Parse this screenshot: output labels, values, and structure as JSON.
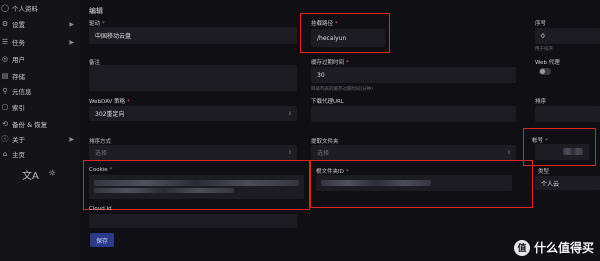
{
  "sidebar": {
    "items": [
      {
        "icon": "person-icon",
        "glyph": "◯",
        "label": "个人资料",
        "chevron": false
      },
      {
        "icon": "gear-icon",
        "glyph": "⚙",
        "label": "设置",
        "chevron": true
      },
      {
        "icon": "task-icon",
        "glyph": "☰",
        "label": "任务",
        "chevron": true
      },
      {
        "icon": "users-icon",
        "glyph": "◎",
        "label": "用户",
        "chevron": false
      },
      {
        "icon": "storage-icon",
        "glyph": "▤",
        "label": "存储",
        "chevron": false
      },
      {
        "icon": "meta-icon",
        "glyph": "⚲",
        "label": "元信息",
        "chevron": false
      },
      {
        "icon": "index-icon",
        "glyph": "▢",
        "label": "索引",
        "chevron": false
      },
      {
        "icon": "backup-icon",
        "glyph": "⟲",
        "label": "备份 & 恢复",
        "chevron": false
      },
      {
        "icon": "about-icon",
        "glyph": "ⓘ",
        "label": "关于",
        "chevron": true
      },
      {
        "icon": "home-icon",
        "glyph": "⌂",
        "label": "主页",
        "chevron": false
      }
    ],
    "language_glyph": "文A",
    "theme_glyph": "☼"
  },
  "form": {
    "title": "编辑",
    "driver": {
      "label": "驱动",
      "value": "中国移动云盘"
    },
    "mount_path": {
      "label": "挂载路径",
      "value": "/hecaiyun"
    },
    "order": {
      "label": "序号",
      "value": "0",
      "hint": "用于排序"
    },
    "remark": {
      "label": "备注",
      "value": ""
    },
    "cache": {
      "label": "缓存过期时间",
      "value": "30",
      "hint": "目录列表的缓存过期时间(分钟)"
    },
    "web_proxy": {
      "label": "Web 代理"
    },
    "webdav_policy": {
      "label": "WebDAV 策略",
      "value": "302重定向"
    },
    "download_proxy": {
      "label": "下载代理URL",
      "value": ""
    },
    "sort": {
      "label": "排序"
    },
    "order_by": {
      "label": "排序方式",
      "value": "选择"
    },
    "extract_folder": {
      "label": "提取文件夹",
      "value": "选择"
    },
    "account": {
      "label": "帐号"
    },
    "cookie": {
      "label": "Cookie"
    },
    "root_folder": {
      "label": "根文件夹ID"
    },
    "type": {
      "label": "类型",
      "value": "个人云"
    },
    "cloud_id": {
      "label": "Cloud Id"
    },
    "save_label": "保存"
  },
  "watermark": {
    "badge": "值",
    "text": "什么值得买"
  }
}
